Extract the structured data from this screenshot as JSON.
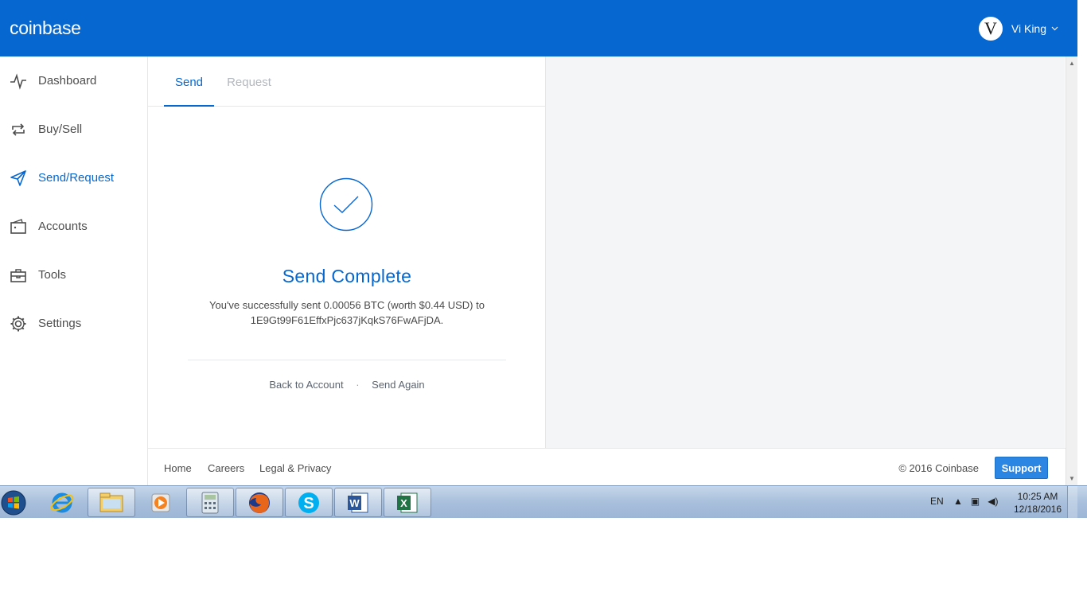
{
  "header": {
    "logo": "coinbase",
    "user_initial": "V",
    "user_name": "Vi King",
    "chevron": "⌵"
  },
  "sidebar": {
    "items": [
      {
        "label": "Dashboard",
        "icon": "activity-icon"
      },
      {
        "label": "Buy/Sell",
        "icon": "exchange-icon"
      },
      {
        "label": "Send/Request",
        "icon": "send-icon",
        "active": true
      },
      {
        "label": "Accounts",
        "icon": "wallet-icon"
      },
      {
        "label": "Tools",
        "icon": "toolbox-icon"
      },
      {
        "label": "Settings",
        "icon": "gear-icon"
      }
    ]
  },
  "tabs": {
    "send": "Send",
    "request": "Request"
  },
  "result": {
    "title": "Send Complete",
    "message_line1": "You've successfully sent 0.00056 BTC (worth $0.44 USD) to",
    "message_line2": "1E9Gt99F61EffxPjc637jKqkS76FwAFjDA.",
    "back_link": "Back to Account",
    "separator": "·",
    "send_again_link": "Send Again"
  },
  "footer": {
    "links": [
      "Home",
      "Careers",
      "Legal & Privacy"
    ],
    "copyright": "© 2016 Coinbase",
    "support": "Support"
  },
  "taskbar": {
    "language": "EN",
    "time": "10:25 AM",
    "date": "12/18/2016"
  },
  "colors": {
    "brand_blue": "#0667d0",
    "support_blue": "#2b86e3",
    "panel_bg": "#f3f5f7"
  }
}
